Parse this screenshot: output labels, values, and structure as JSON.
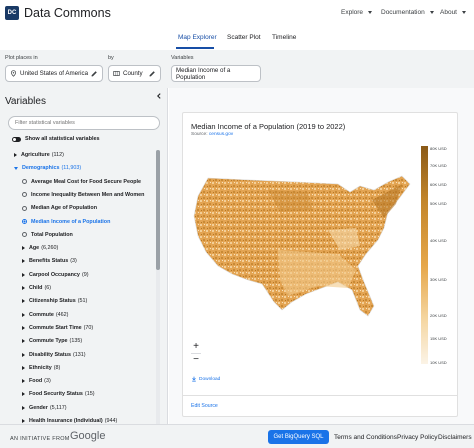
{
  "header": {
    "logo_text": "DC",
    "brand": "Data Commons",
    "nav": [
      {
        "label": "Explore",
        "icon": "chevron-down-icon"
      },
      {
        "label": "Documentation",
        "icon": "chevron-down-icon"
      },
      {
        "label": "About",
        "icon": "chevron-down-icon"
      }
    ]
  },
  "tabs": [
    {
      "label": "Map Explorer",
      "active": true
    },
    {
      "label": "Scatter Plot",
      "active": false
    },
    {
      "label": "Timeline",
      "active": false
    }
  ],
  "selectors": {
    "places_label": "Plot places in",
    "places_value": "United States of America",
    "by_label": "by",
    "by_value": "County",
    "variables_label": "Variables",
    "variables_value": "Median Income of a Population"
  },
  "sidebar": {
    "title": "Variables",
    "filter_placeholder": "Filter statistical variables",
    "toggle_label": "Show all statistical variables",
    "items": [
      {
        "label": "Agriculture",
        "count": "(112)",
        "type": "group"
      },
      {
        "label": "Demographics",
        "count": "(11,903)",
        "type": "group-open"
      },
      {
        "label": "Average Meal Cost for Food Secure People",
        "count": "",
        "type": "radio"
      },
      {
        "label": "Income Inequality Between Men and Women",
        "count": "",
        "type": "radio"
      },
      {
        "label": "Median Age of Population",
        "count": "",
        "type": "radio"
      },
      {
        "label": "Median Income of a Population",
        "count": "",
        "type": "radio-on"
      },
      {
        "label": "Total Population",
        "count": "",
        "type": "radio"
      },
      {
        "label": "Age",
        "count": "(6,260)",
        "type": "sub"
      },
      {
        "label": "Benefits Status",
        "count": "(3)",
        "type": "sub"
      },
      {
        "label": "Carpool Occupancy",
        "count": "(9)",
        "type": "sub"
      },
      {
        "label": "Child",
        "count": "(6)",
        "type": "sub"
      },
      {
        "label": "Citizenship Status",
        "count": "(51)",
        "type": "sub"
      },
      {
        "label": "Commute",
        "count": "(462)",
        "type": "sub"
      },
      {
        "label": "Commute Start Time",
        "count": "(70)",
        "type": "sub"
      },
      {
        "label": "Commute Type",
        "count": "(135)",
        "type": "sub"
      },
      {
        "label": "Disability Status",
        "count": "(131)",
        "type": "sub"
      },
      {
        "label": "Ethnicity",
        "count": "(8)",
        "type": "sub"
      },
      {
        "label": "Food",
        "count": "(3)",
        "type": "sub"
      },
      {
        "label": "Food Security Status",
        "count": "(15)",
        "type": "sub"
      },
      {
        "label": "Gender",
        "count": "(5,117)",
        "type": "sub"
      },
      {
        "label": "Health Insurance (Individual)",
        "count": "(944)",
        "type": "sub"
      }
    ]
  },
  "chart": {
    "title": "Median Income of a Population (2019 to 2022)",
    "source_prefix": "Source:",
    "source_link": "census.gov",
    "legend": [
      "80K USD",
      "70K USD",
      "60K USD",
      "50K USD",
      "40K USD",
      "30K USD",
      "20K USD",
      "15K USD",
      "10K USD"
    ],
    "zoom_in": "+",
    "zoom_out": "−",
    "download": "Download",
    "edit_source": "Edit Source"
  },
  "footer": {
    "initiative": "AN INITIATIVE FROM",
    "google": "Google",
    "bigquery": "Get BigQuery SQL",
    "links": [
      "Terms and Conditions",
      "Privacy Policy",
      "Disclaimers"
    ]
  },
  "colors": {
    "accent": "#1a73e8",
    "map_dark": "#8a5a17",
    "map_light": "#fbf3e6"
  }
}
